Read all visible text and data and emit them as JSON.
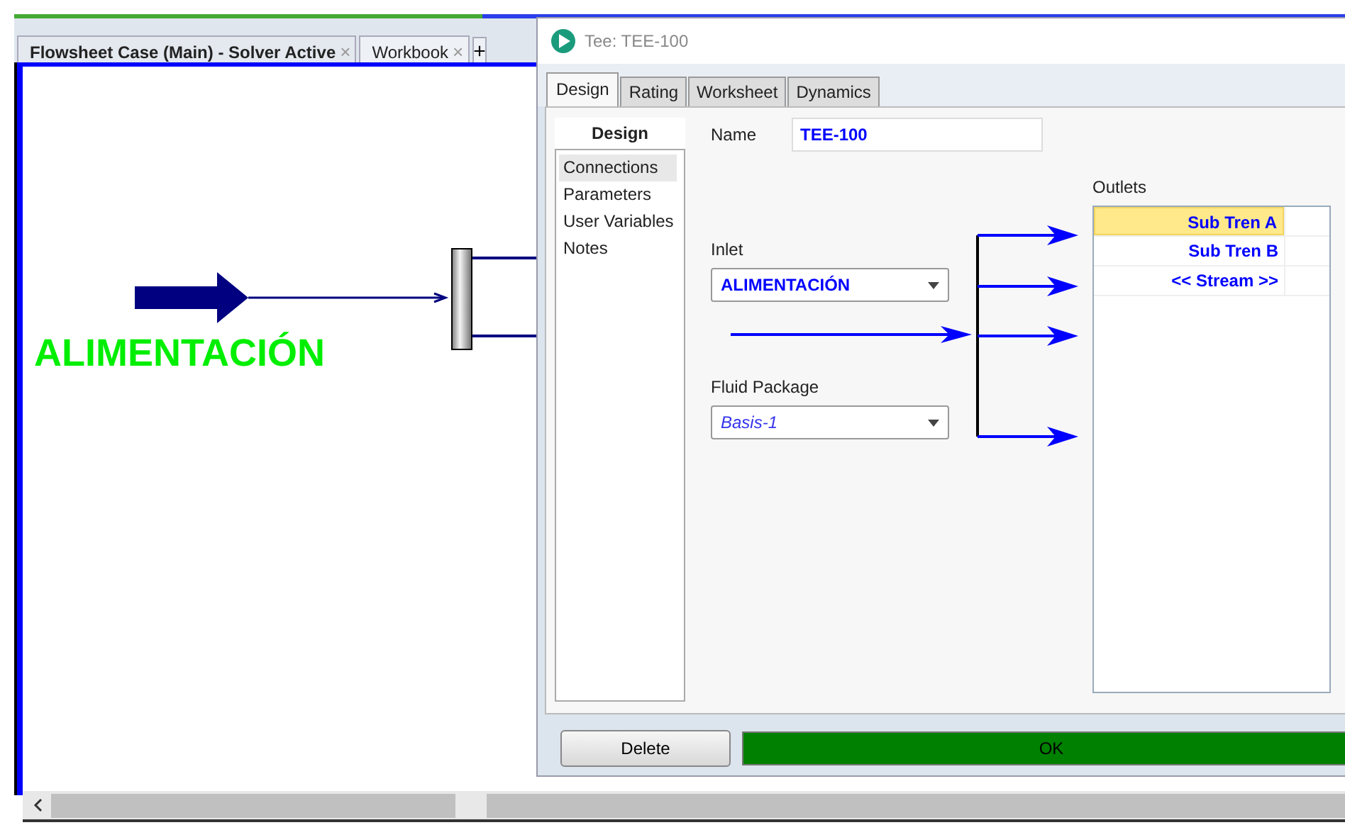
{
  "tabs": [
    {
      "label": "Flowsheet Case (Main) - Solver Active",
      "close": "×",
      "selected": true
    },
    {
      "label": "Workbook",
      "close": "×",
      "selected": false
    }
  ],
  "new_tab": "+",
  "flowsheet": {
    "feed_label": "ALIMENTACIÓN"
  },
  "dialog": {
    "title": "Tee: TEE-100",
    "tabs": [
      {
        "label": "Design",
        "selected": true
      },
      {
        "label": "Rating",
        "selected": false
      },
      {
        "label": "Worksheet",
        "selected": false
      },
      {
        "label": "Dynamics",
        "selected": false
      }
    ],
    "nav": {
      "heading": "Design",
      "items": [
        {
          "label": "Connections",
          "selected": true
        },
        {
          "label": "Parameters",
          "selected": false
        },
        {
          "label": "User Variables",
          "selected": false
        },
        {
          "label": "Notes",
          "selected": false
        }
      ]
    },
    "name": {
      "label": "Name",
      "value": "TEE-100"
    },
    "inlet": {
      "label": "Inlet",
      "value": "ALIMENTACIÓN"
    },
    "fluid_package": {
      "label": "Fluid Package",
      "value": "Basis-1"
    },
    "outlets": {
      "label": "Outlets",
      "rows": [
        {
          "value": "Sub Tren A",
          "selected": true
        },
        {
          "value": "Sub Tren B",
          "selected": false
        },
        {
          "value": "<< Stream >>",
          "selected": false
        }
      ]
    },
    "buttons": {
      "delete": "Delete",
      "ok": "OK"
    }
  }
}
